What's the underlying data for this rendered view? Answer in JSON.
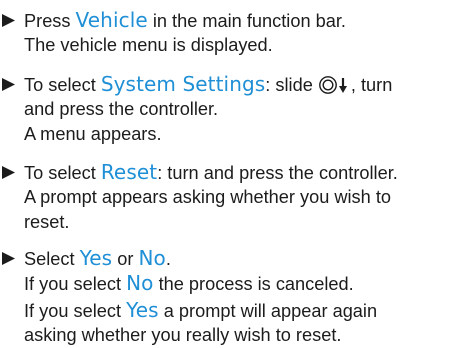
{
  "steps": [
    {
      "lines": [
        [
          "Press ",
          {
            "kw": "Vehicle"
          },
          " in the main function bar."
        ],
        [
          "The vehicle menu is displayed."
        ]
      ]
    },
    {
      "lines": [
        [
          "To select ",
          {
            "kw": "System Settings"
          },
          ": slide ",
          {
            "icon": "controller-slide-down-icon"
          },
          ", turn"
        ],
        [
          "and press the controller."
        ],
        [
          "A menu appears."
        ]
      ]
    },
    {
      "lines": [
        [
          "To select ",
          {
            "kw": "Reset"
          },
          ": turn and press the controller."
        ],
        [
          "A prompt appears asking whether you wish to"
        ],
        [
          "reset."
        ]
      ]
    },
    {
      "lines": [
        [
          "Select ",
          {
            "kw": "Yes"
          },
          " or ",
          {
            "kw": "No"
          },
          "."
        ],
        [
          "If you select ",
          {
            "kw": "No"
          },
          " the process is canceled."
        ],
        [
          "If you select ",
          {
            "kw": "Yes"
          },
          " a prompt will appear again"
        ],
        [
          "asking whether you really wish to reset."
        ]
      ]
    }
  ]
}
